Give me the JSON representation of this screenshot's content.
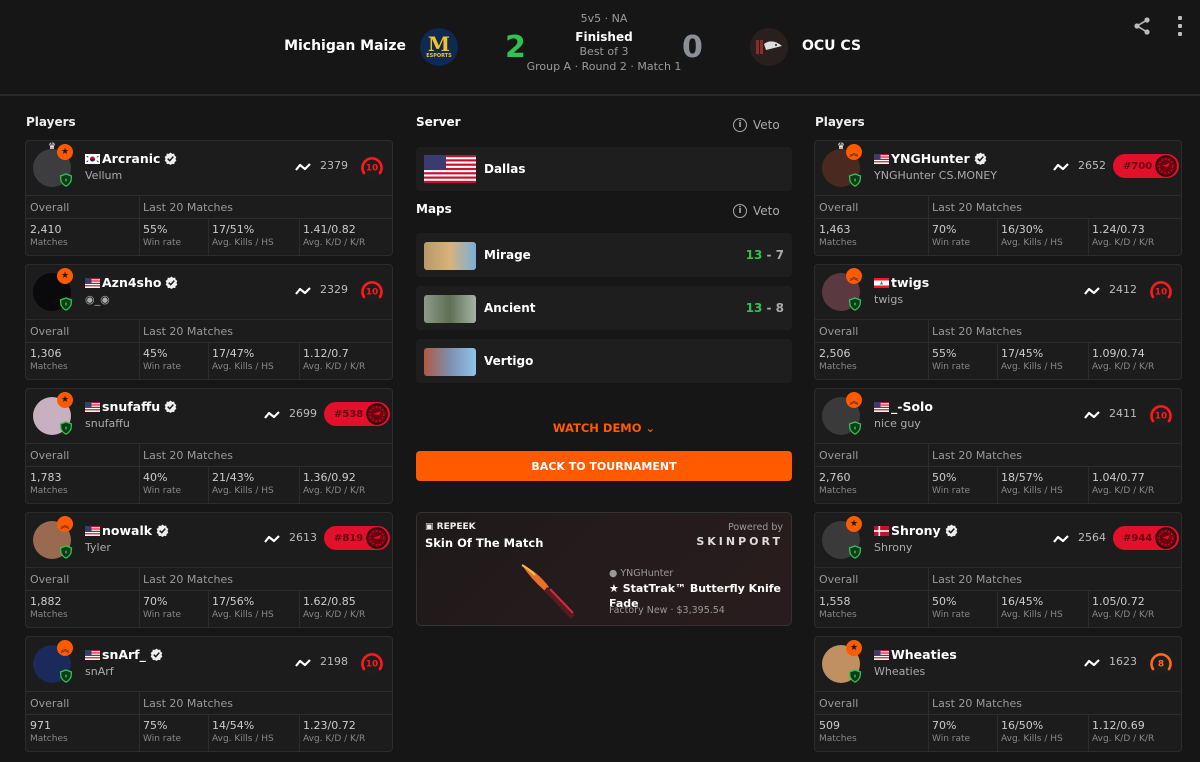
{
  "header": {
    "team_left": "Michigan Maize",
    "team_right": "OCU CS",
    "score_left": "2",
    "score_right": "0",
    "format": "5v5 · NA",
    "status": "Finished",
    "best_of": "Best of 3",
    "round_info": "Group A · Round 2 · Match 1",
    "logo_left_text": "M",
    "logo_left_sub": "ESPORTS",
    "colors": {
      "win": "#32c252",
      "lose": "#8a8f98",
      "accent": "#ff5a00"
    }
  },
  "labels": {
    "players": "Players",
    "overall": "Overall",
    "last20": "Last 20 Matches",
    "matches": "Matches",
    "win_rate": "Win rate",
    "kills_hs": "Avg. Kills / HS",
    "kd_kr": "Avg. K/D / K/R"
  },
  "left_players": [
    {
      "name": "Arcranic",
      "sub": "Vellum",
      "flag": "kr",
      "verified": true,
      "crown": true,
      "badge": "star",
      "elo": "2379",
      "level": "10",
      "rank": null,
      "matches": "2,410",
      "win_rate": "55%",
      "kills_hs": "17/51%",
      "kd_kr": "1.41/0.82"
    },
    {
      "name": "Azn4sho",
      "sub": "◉_◉",
      "flag": "us",
      "verified": true,
      "crown": false,
      "badge": "star",
      "elo": "2329",
      "level": "10",
      "rank": null,
      "matches": "1,306",
      "win_rate": "45%",
      "kills_hs": "17/47%",
      "kd_kr": "1.12/0.7"
    },
    {
      "name": "snufaffu",
      "sub": "snufaffu",
      "flag": "us",
      "verified": true,
      "crown": false,
      "badge": "star",
      "elo": "2699",
      "level": null,
      "rank": "#538",
      "matches": "1,783",
      "win_rate": "40%",
      "kills_hs": "21/43%",
      "kd_kr": "1.36/0.92"
    },
    {
      "name": "nowalk",
      "sub": "Tyler",
      "flag": "us",
      "verified": true,
      "crown": false,
      "badge": "chevron",
      "elo": "2613",
      "level": null,
      "rank": "#819",
      "matches": "1,882",
      "win_rate": "70%",
      "kills_hs": "17/56%",
      "kd_kr": "1.62/0.85"
    },
    {
      "name": "snArf_",
      "sub": "snArf",
      "flag": "us",
      "verified": true,
      "crown": false,
      "badge": "chevron",
      "elo": "2198",
      "level": "10",
      "rank": null,
      "matches": "971",
      "win_rate": "75%",
      "kills_hs": "14/54%",
      "kd_kr": "1.23/0.72"
    }
  ],
  "right_players": [
    {
      "name": "YNGHunter",
      "sub": "YNGHunter CS.MONEY",
      "flag": "us",
      "verified": true,
      "crown": true,
      "badge": "chevron",
      "elo": "2652",
      "level": null,
      "rank": "#700",
      "matches": "1,463",
      "win_rate": "70%",
      "kills_hs": "16/30%",
      "kd_kr": "1.24/0.73"
    },
    {
      "name": "twigs",
      "sub": "twigs",
      "flag": "lb",
      "verified": false,
      "crown": false,
      "badge": "chevron",
      "elo": "2412",
      "level": "10",
      "rank": null,
      "matches": "2,506",
      "win_rate": "55%",
      "kills_hs": "17/45%",
      "kd_kr": "1.09/0.74"
    },
    {
      "name": "_-Solo",
      "sub": "nice guy",
      "flag": "us",
      "verified": false,
      "crown": false,
      "badge": "chevron",
      "elo": "2411",
      "level": "10",
      "rank": null,
      "matches": "2,760",
      "win_rate": "50%",
      "kills_hs": "18/57%",
      "kd_kr": "1.04/0.77"
    },
    {
      "name": "Shrony",
      "sub": "Shrony",
      "flag": "dk",
      "verified": true,
      "crown": false,
      "badge": "star",
      "elo": "2564",
      "level": null,
      "rank": "#944",
      "matches": "1,558",
      "win_rate": "50%",
      "kills_hs": "16/45%",
      "kd_kr": "1.05/0.72"
    },
    {
      "name": "Wheaties",
      "sub": "Wheaties",
      "flag": "us",
      "verified": false,
      "crown": false,
      "badge": "star",
      "elo": "1623",
      "level": "8",
      "rank": null,
      "matches": "509",
      "win_rate": "70%",
      "kills_hs": "16/50%",
      "kd_kr": "1.12/0.69"
    }
  ],
  "center": {
    "server_title": "Server",
    "maps_title": "Maps",
    "veto_label": "Veto",
    "server": "Dallas",
    "maps": [
      {
        "name": "Mirage",
        "score_a": "13",
        "score_b": "7"
      },
      {
        "name": "Ancient",
        "score_a": "13",
        "score_b": "8"
      },
      {
        "name": "Vertigo",
        "score_a": "",
        "score_b": ""
      }
    ],
    "watch_demo": "WATCH DEMO",
    "back_button": "BACK TO TOURNAMENT"
  },
  "skin": {
    "brand": "REPEEK",
    "title": "Skin Of The Match",
    "powered_by": "Powered by",
    "sponsor": "SKINPORT",
    "owner": "YNGHunter",
    "name": "★ StatTrak™ Butterfly Knife Fade",
    "price": "Factory New · $3,395.54"
  }
}
